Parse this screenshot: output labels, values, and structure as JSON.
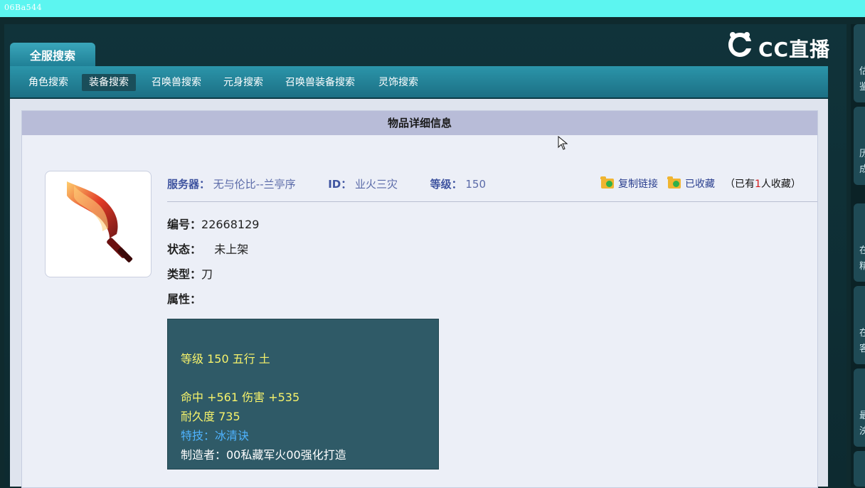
{
  "top_badge": "06Ba544",
  "brand": {
    "name": "CC直播"
  },
  "tabs": {
    "main": "全服搜索"
  },
  "subnav": {
    "items": [
      {
        "label": "角色搜索",
        "active": false
      },
      {
        "label": "装备搜索",
        "active": true
      },
      {
        "label": "召唤兽搜索",
        "active": false
      },
      {
        "label": "元身搜索",
        "active": false
      },
      {
        "label": "召唤兽装备搜索",
        "active": false
      },
      {
        "label": "灵饰搜索",
        "active": false
      }
    ]
  },
  "panel": {
    "title": "物品详细信息",
    "server_label": "服务器：",
    "server_value": "无与伦比--兰亭序",
    "id_label": "ID：",
    "id_value": "业火三灾",
    "level_label": "等级：",
    "level_value": "150",
    "actions": {
      "copy_link": "复制链接",
      "favorited": "已收藏",
      "count_prefix": "（已有",
      "count_value": "1",
      "count_suffix": "人收藏）"
    },
    "fields": {
      "serial_label": "编号：",
      "serial_value": "22668129",
      "status_label": "状态：",
      "status_value": "未上架",
      "type_label": "类型：",
      "type_value": "刀",
      "attr_label": "属性："
    },
    "stats": {
      "line1": "等级 150 五行 土",
      "line2": "命中 +561 伤害 +535",
      "line3": "耐久度 735",
      "line4": "特技：冰清诀",
      "line5": "制造者：00私藏军火00强化打造"
    }
  },
  "right_rail": {
    "card1": "估\n鉴",
    "card2": "历\n成",
    "card3": "在\n精",
    "card4": "在\n客",
    "card5": "最\n泱"
  },
  "colors": {
    "topbar": "#5cf5f0",
    "subnav": "#2b95aa",
    "panel_head": "#b8bcd8",
    "stats_bg": "#2f5a67",
    "stats_yellow": "#f7f36b",
    "stats_blue": "#4fb3ff"
  },
  "icons": {
    "folder_copy": "folder-copy-icon",
    "folder_fav": "folder-favorite-icon",
    "mouse_cursor": "mouse-cursor-icon"
  }
}
